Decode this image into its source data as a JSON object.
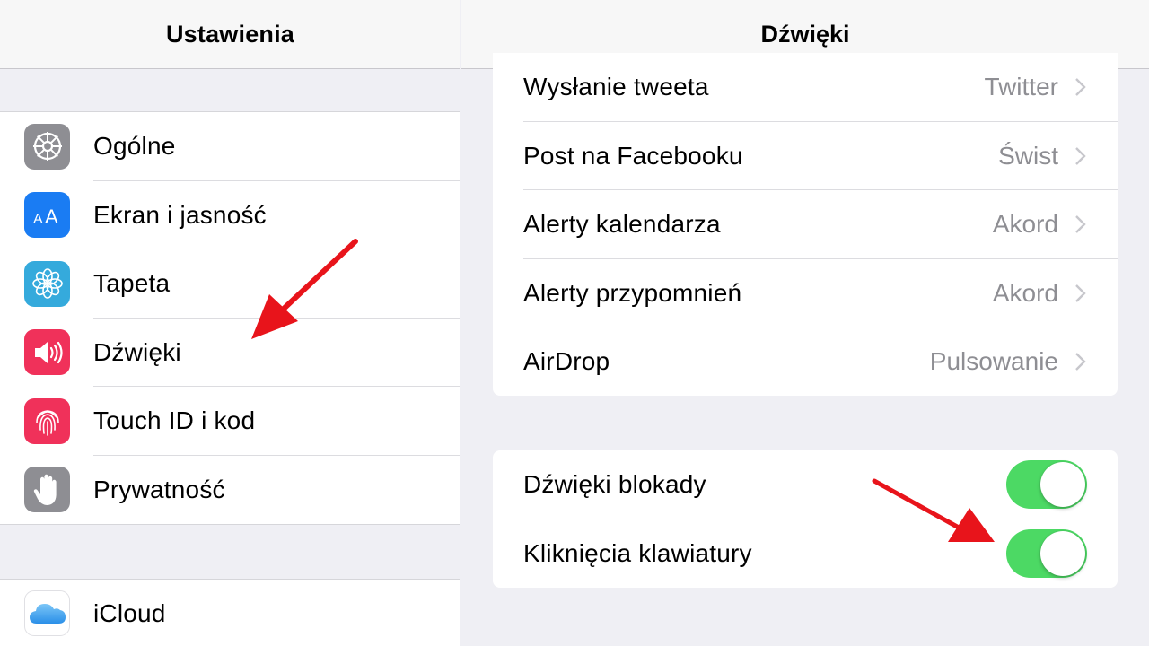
{
  "left": {
    "title": "Ustawienia",
    "items": [
      {
        "label": "Ogólne",
        "icon": "gear-icon",
        "color": "#8e8e93"
      },
      {
        "label": "Ekran i jasność",
        "icon": "text-size-icon",
        "color": "#1a7cf3"
      },
      {
        "label": "Tapeta",
        "icon": "flower-icon",
        "color": "#35aadc"
      },
      {
        "label": "Dźwięki",
        "icon": "speaker-icon",
        "color": "#f0315a"
      },
      {
        "label": "Touch ID i kod",
        "icon": "fingerprint-icon",
        "color": "#f0315a"
      },
      {
        "label": "Prywatność",
        "icon": "hand-icon",
        "color": "#8e8e93"
      }
    ],
    "icloud": {
      "label": "iCloud",
      "icon": "cloud-icon"
    }
  },
  "right": {
    "title": "Dźwięki",
    "tones": [
      {
        "label": "Wysłanie tweeta",
        "value": "Twitter"
      },
      {
        "label": "Post na Facebooku",
        "value": "Świst"
      },
      {
        "label": "Alerty kalendarza",
        "value": "Akord"
      },
      {
        "label": "Alerty przypomnień",
        "value": "Akord"
      },
      {
        "label": "AirDrop",
        "value": "Pulsowanie"
      }
    ],
    "toggles": [
      {
        "label": "Dźwięki blokady",
        "on": true
      },
      {
        "label": "Kliknięcia klawiatury",
        "on": true
      }
    ]
  },
  "colors": {
    "toggle_on": "#4cd964",
    "arrow": "#e8141b"
  }
}
